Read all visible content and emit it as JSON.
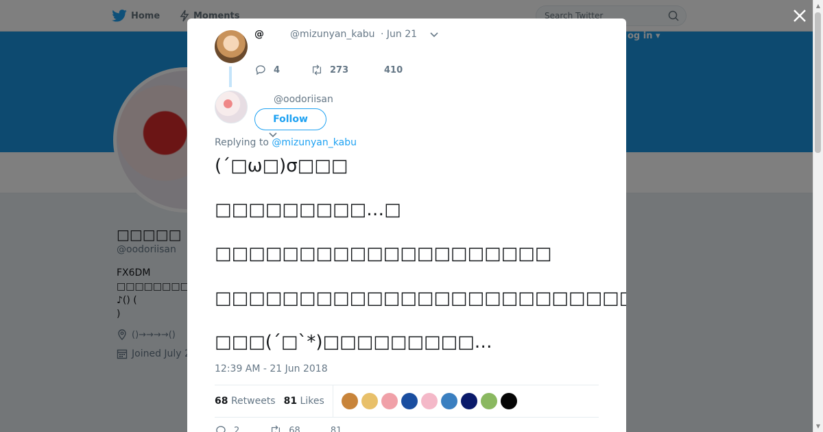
{
  "nav": {
    "home_label": "Home",
    "moments_label": "Moments",
    "search_placeholder": "Search Twitter",
    "login_label": "og in ▾"
  },
  "profile": {
    "name": "□□□□□",
    "handle": "@oodoriisan",
    "bio_line1": "FX6DM",
    "bio_line2": "□□□□□□□□□□□□□□□",
    "bio_line3": "♪() (",
    "bio_line4": ")",
    "location": "()→→→→()",
    "joined": "Joined July 2"
  },
  "context_tweet": {
    "name": "@",
    "handle": "@mizunyan_kabu",
    "date": "· Jun 21",
    "replies": "4",
    "retweets": "273",
    "likes": "410"
  },
  "tweet": {
    "handle": "@oodoriisan",
    "follow_label": "Follow",
    "replying_prefix": "Replying to ",
    "replying_to": "@mizunyan_kabu",
    "lines": [
      "(´□ω□)σ□□□",
      "□□□□□□□□□…□",
      "□□□□□□□□□□□□□□□□□□□□",
      "□□□□□□□□□□□□□□□□□□□□□□□□□",
      "□□□(´□`*)□□□□□□□□□…"
    ],
    "anger_emoji": "💢",
    "timestamp": "12:39 AM - 21 Jun 2018",
    "retweet_count": "68",
    "retweet_label": "Retweets",
    "like_count": "81",
    "like_label": "Likes",
    "bottom_replies": "2",
    "bottom_retweets": "68",
    "bottom_likes": "81"
  },
  "likers": [
    "#c8843a",
    "#e8c06a",
    "#f0a0a8",
    "#1a4ea0",
    "#f4b8c8",
    "#3a7fc0",
    "#0a1a6a",
    "#8ab860",
    "#050505"
  ],
  "colors": {
    "accent": "#1da1f2",
    "banner": "#1b95e0"
  }
}
